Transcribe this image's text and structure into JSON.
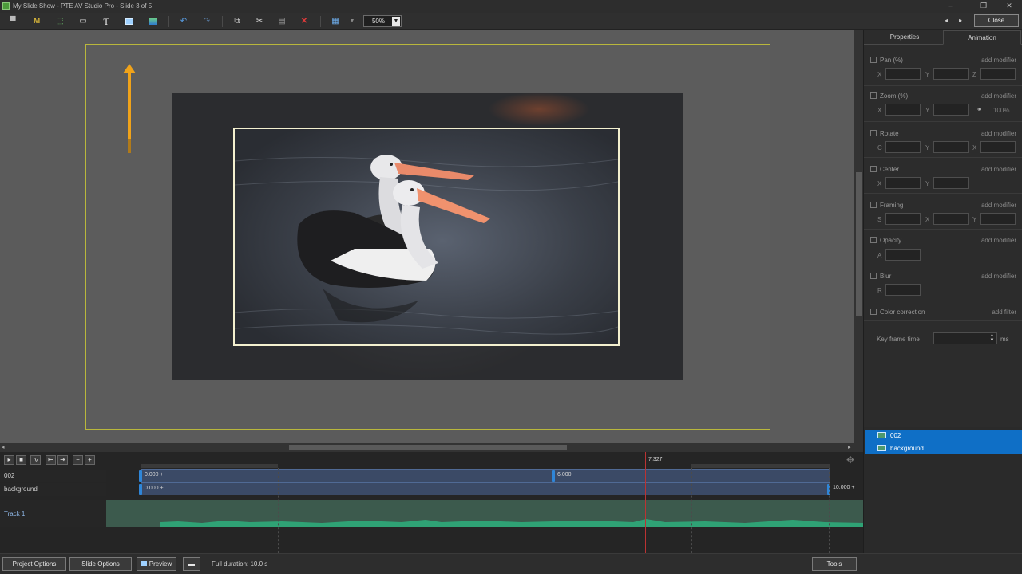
{
  "window": {
    "title": "My Slide Show - PTE AV Studio Pro - Slide 3 of 5"
  },
  "toolbar": {
    "zoom_value": "50%",
    "close_label": "Close",
    "icons": [
      "projector-icon",
      "text-m-icon",
      "frame-icon",
      "image-icon",
      "text-icon",
      "rectangle-icon",
      "mask-icon",
      "undo-icon",
      "redo-icon",
      "copy-icon",
      "cut-icon",
      "paste-icon",
      "delete-icon",
      "grid-icon"
    ]
  },
  "panel": {
    "tabs": [
      {
        "label": "Properties"
      },
      {
        "label": "Animation"
      }
    ],
    "active_tab": "Animation",
    "add_modifier": "add modifier",
    "add_filter": "add filter",
    "sections": {
      "pan": {
        "label": "Pan (%)",
        "x": "X",
        "y": "Y",
        "z": "Z"
      },
      "zoom": {
        "label": "Zoom (%)",
        "x": "X",
        "y": "Y",
        "pct": "100%"
      },
      "rotate": {
        "label": "Rotate",
        "c": "C",
        "y": "Y",
        "x": "X"
      },
      "center": {
        "label": "Center",
        "x": "X",
        "y": "Y"
      },
      "framing": {
        "label": "Framing",
        "s": "S",
        "x": "X",
        "y": "Y"
      },
      "opacity": {
        "label": "Opacity",
        "a": "A"
      },
      "blur": {
        "label": "Blur",
        "r": "R"
      },
      "color": {
        "label": "Color correction"
      }
    },
    "keyframe": {
      "label": "Key frame time",
      "unit": "ms"
    },
    "layers": [
      {
        "name": "002"
      },
      {
        "name": "background"
      }
    ]
  },
  "timeline": {
    "playhead_time": "7.327",
    "tracks": [
      {
        "name": "002",
        "start_label": "0.000 +",
        "mid_label": "6.000"
      },
      {
        "name": "background",
        "start_label": "0.000 +",
        "end_label": "10.000 +"
      }
    ],
    "audio_track": "Track 1"
  },
  "bottom": {
    "project_options": "Project Options",
    "slide_options": "Slide Options",
    "preview": "Preview",
    "full_duration": "Full duration: 10.0 s",
    "tools": "Tools"
  }
}
